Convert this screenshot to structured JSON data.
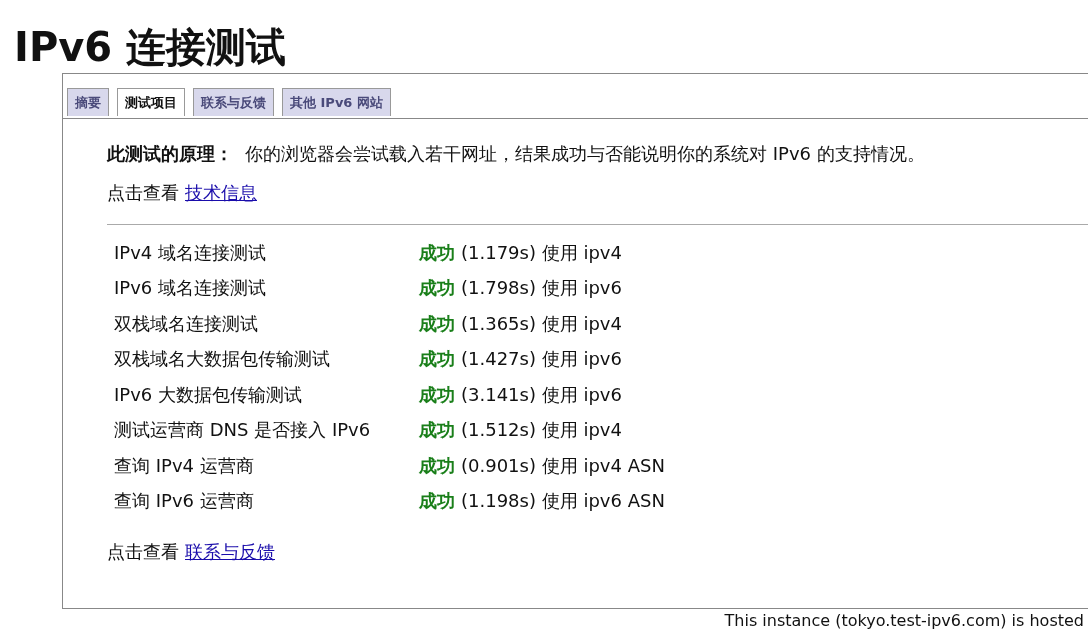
{
  "title": "IPv6 连接测试",
  "tabs": [
    {
      "label": "摘要",
      "selected": false
    },
    {
      "label": "测试项目",
      "selected": true
    },
    {
      "label": "联系与反馈",
      "selected": false
    },
    {
      "label": "其他 IPv6 网站",
      "selected": false
    }
  ],
  "principle": {
    "label": "此测试的原理：",
    "text": "你的浏览器会尝试载入若干网址，结果成功与否能说明你的系统对 IPv6 的支持情况。"
  },
  "info_link": {
    "prefix": "点击查看",
    "link": "技术信息"
  },
  "tests": [
    {
      "name": "IPv4 域名连接测试",
      "status": "成功",
      "ok": true,
      "detail": "(1.179s) 使用 ipv4"
    },
    {
      "name": "IPv6 域名连接测试",
      "status": "成功",
      "ok": true,
      "detail": "(1.798s) 使用 ipv6"
    },
    {
      "name": "双栈域名连接测试",
      "status": "成功",
      "ok": true,
      "detail": "(1.365s) 使用 ipv4"
    },
    {
      "name": "双栈域名大数据包传输测试",
      "status": "成功",
      "ok": true,
      "detail": "(1.427s) 使用 ipv6"
    },
    {
      "name": "IPv6 大数据包传输测试",
      "status": "成功",
      "ok": true,
      "detail": "(3.141s) 使用 ipv6"
    },
    {
      "name": "测试运营商 DNS 是否接入 IPv6",
      "status": "成功",
      "ok": true,
      "detail": "(1.512s) 使用 ipv4"
    },
    {
      "name": "查询 IPv4 运营商",
      "status": "成功",
      "ok": true,
      "detail": "(0.901s) 使用 ipv4 ASN"
    },
    {
      "name": "查询 IPv6 运营商",
      "status": "成功",
      "ok": true,
      "detail": "(1.198s) 使用 ipv6 ASN"
    }
  ],
  "contact_link": {
    "prefix": "点击查看",
    "link": "联系与反馈"
  },
  "footer": "This instance (tokyo.test-ipv6.com) is hosted"
}
